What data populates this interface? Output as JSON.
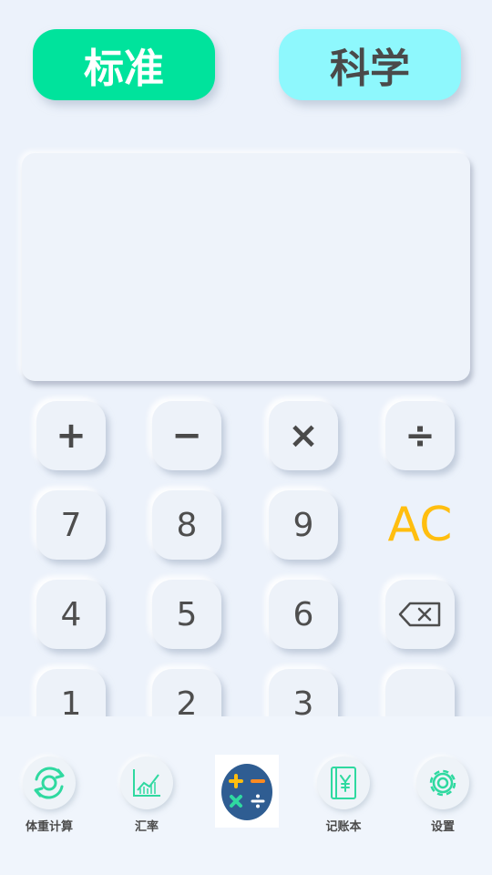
{
  "mode_tabs": {
    "standard": "标准",
    "scientific": "科学"
  },
  "display": {
    "value": ""
  },
  "keys": {
    "plus": "+",
    "minus": "−",
    "multiply": "×",
    "divide": "÷",
    "n7": "7",
    "n8": "8",
    "n9": "9",
    "ac": "AC",
    "n4": "4",
    "n5": "5",
    "n6": "6",
    "n1": "1",
    "n2": "2",
    "n3": "3"
  },
  "nav": {
    "bmi": "体重计算",
    "exchange": "汇率",
    "ledger": "记账本",
    "settings": "设置"
  },
  "colors": {
    "accent_green": "#00e39c",
    "accent_cyan": "#8ef8fd",
    "ac_yellow": "#ffbe0f",
    "icon_green": "#2fd9a0",
    "calc_icon_bg": "#2f5d92"
  },
  "icons": {
    "backspace": "backspace-icon",
    "bmi": "refresh-circle-icon",
    "exchange": "chart-icon",
    "calculator": "calculator-icon",
    "ledger": "yen-book-icon",
    "settings": "gear-icon"
  }
}
